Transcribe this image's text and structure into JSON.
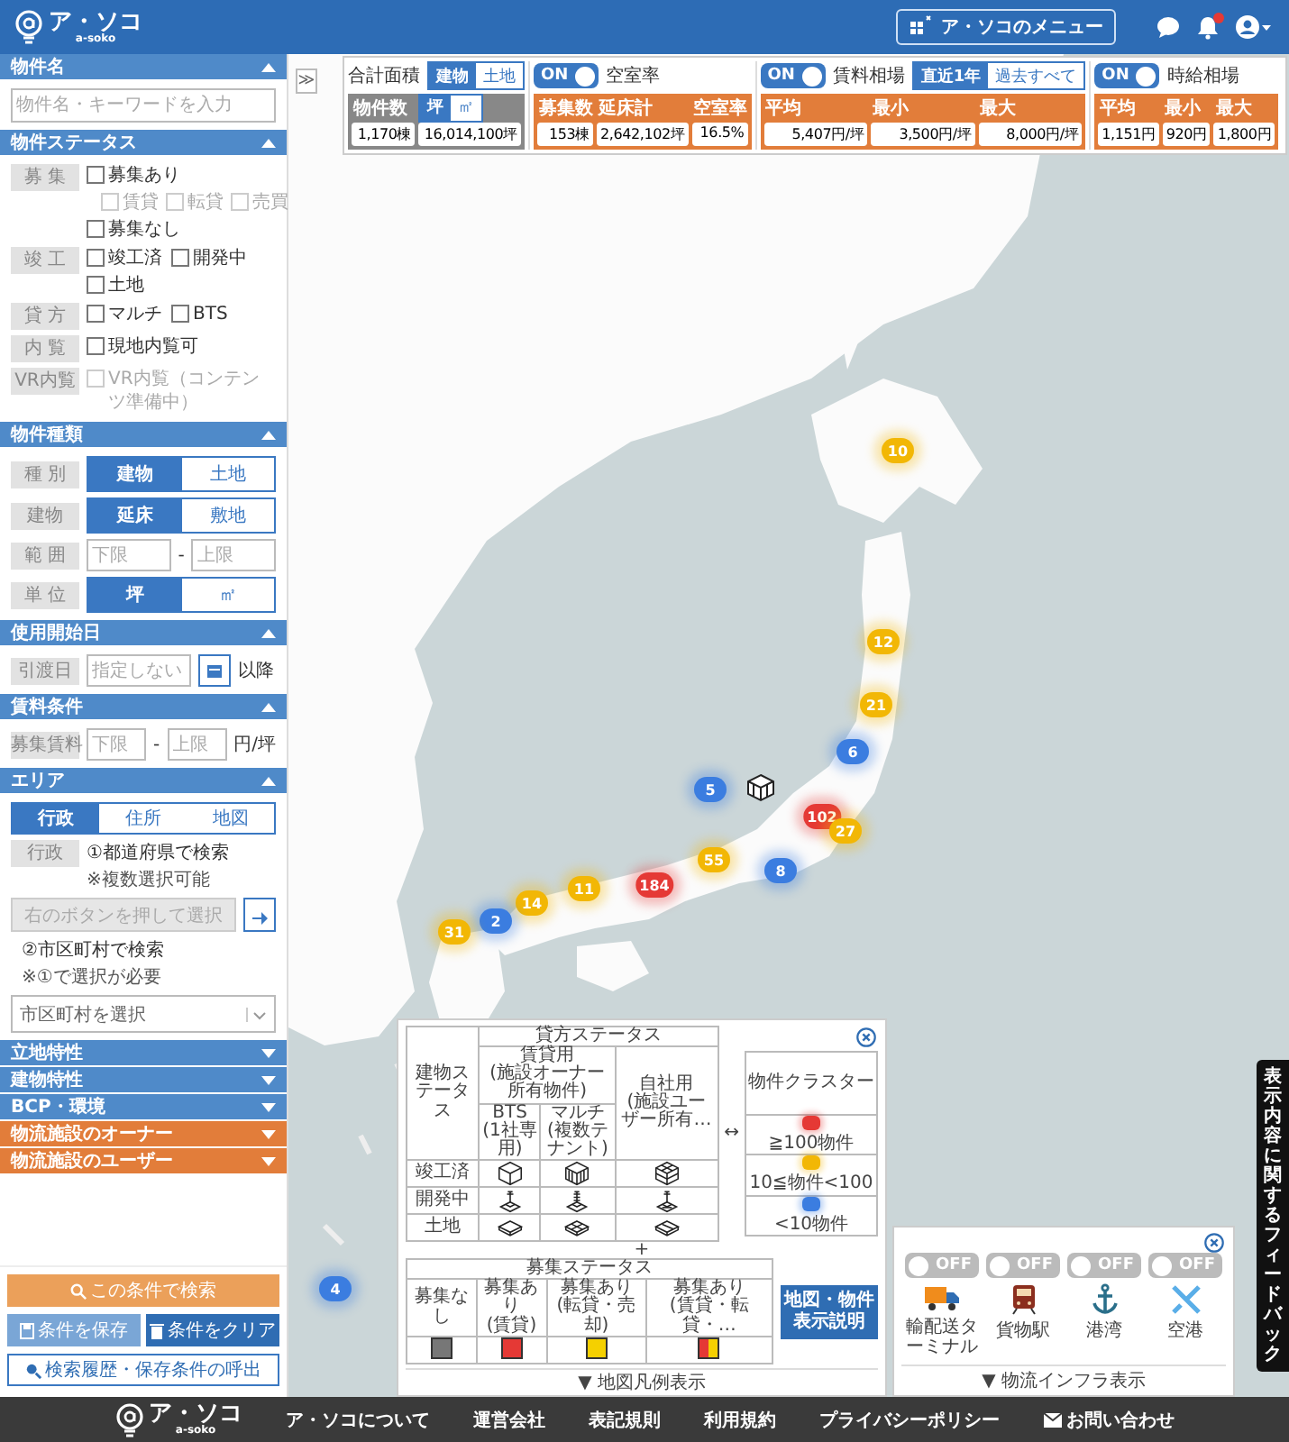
{
  "header": {
    "logo": "ア・ソコ",
    "logo_sub": "a-soko",
    "menu_button": "ア・ソコのメニュー"
  },
  "sidebar": {
    "sections": [
      {
        "kind": "keyword",
        "title": "物件名",
        "expanded": true,
        "color": "#4f8ac9",
        "placeholder": "物件名・キーワードを入力"
      },
      {
        "kind": "status",
        "title": "物件ステータス",
        "expanded": true,
        "color": "#4f8ac9",
        "rows": [
          {
            "label": "募 集",
            "kind": "stack",
            "options": [
              {
                "label": "募集あり",
                "checked": false,
                "disabled": false,
                "children": [
                  {
                    "label": "賃貸",
                    "checked": false,
                    "disabled": true
                  },
                  {
                    "label": "転貸",
                    "checked": false,
                    "disabled": true
                  },
                  {
                    "label": "売買",
                    "checked": false,
                    "disabled": true
                  }
                ]
              },
              {
                "label": "募集なし",
                "checked": false,
                "disabled": false
              }
            ]
          },
          {
            "label": "竣 工",
            "kind": "inline",
            "options": [
              {
                "label": "竣工済",
                "checked": false,
                "disabled": false
              },
              {
                "label": "開発中",
                "checked": false,
                "disabled": false
              },
              {
                "label": "土地",
                "checked": false,
                "disabled": false
              }
            ]
          },
          {
            "label": "貸 方",
            "kind": "inline",
            "options": [
              {
                "label": "マルチ",
                "checked": false,
                "disabled": false
              },
              {
                "label": "BTS",
                "checked": false,
                "disabled": false
              }
            ]
          },
          {
            "label": "内 覧",
            "kind": "inline",
            "options": [
              {
                "label": "現地内覧可",
                "checked": false,
                "disabled": false
              }
            ]
          },
          {
            "label": "VR内覧",
            "kind": "inline",
            "options": [
              {
                "label": "VR内覧（コンテンツ準備中）",
                "checked": false,
                "disabled": true
              }
            ]
          }
        ]
      },
      {
        "kind": "form",
        "title": "物件種類",
        "expanded": true,
        "color": "#4f8ac9",
        "rows": [
          {
            "kind": "segment",
            "label": "種 別",
            "options": [
              {
                "label": "建物",
                "selected": true
              },
              {
                "label": "土地",
                "selected": false
              }
            ]
          },
          {
            "kind": "segment",
            "label": "建物",
            "options": [
              {
                "label": "延床",
                "selected": true
              },
              {
                "label": "敷地",
                "selected": false
              }
            ]
          },
          {
            "kind": "range",
            "label": "範 囲",
            "min_placeholder": "下限",
            "separator": "-",
            "max_placeholder": "上限"
          },
          {
            "kind": "segment",
            "label": "単 位",
            "options": [
              {
                "label": "坪",
                "selected": true
              },
              {
                "label": "㎡",
                "selected": false
              }
            ]
          }
        ]
      },
      {
        "kind": "form",
        "title": "使用開始日",
        "expanded": true,
        "color": "#4f8ac9",
        "rows": [
          {
            "kind": "date",
            "label": "引渡日",
            "placeholder": "指定しない",
            "suffix": "以降"
          }
        ]
      },
      {
        "kind": "form",
        "title": "賃料条件",
        "expanded": true,
        "color": "#4f8ac9",
        "rows": [
          {
            "kind": "range",
            "label": "募集賃料",
            "min_placeholder": "下限",
            "separator": "-",
            "max_placeholder": "上限",
            "suffix": "円/坪"
          }
        ]
      },
      {
        "kind": "area",
        "title": "エリア",
        "expanded": true,
        "color": "#4f8ac9",
        "tabs": [
          {
            "label": "行政",
            "selected": true
          },
          {
            "label": "住所",
            "selected": false
          },
          {
            "label": "地図",
            "selected": false
          }
        ],
        "label": "行政",
        "step1": "①都道府県で検索",
        "step1_note": "※複数選択可能",
        "pick_button": "右のボタンを押して選択",
        "step2": "②市区町村で検索",
        "step2_note": "※①で選択が必要",
        "city_select": "市区町村を選択"
      },
      {
        "kind": "collapsed",
        "title": "立地特性",
        "expanded": false,
        "color": "#4f8ac9"
      },
      {
        "kind": "collapsed",
        "title": "建物特性",
        "expanded": false,
        "color": "#4f8ac9"
      },
      {
        "kind": "collapsed",
        "title": "BCP・環境",
        "expanded": false,
        "color": "#4f8ac9"
      },
      {
        "kind": "collapsed",
        "title": "物流施設のオーナー",
        "expanded": false,
        "color": "#e27d3a"
      },
      {
        "kind": "collapsed",
        "title": "物流施設のユーザー",
        "expanded": false,
        "color": "#e27d3a"
      }
    ],
    "actions": {
      "search": "この条件で検索",
      "save": "条件を保存",
      "clear": "条件をクリア",
      "history": "検索履歴・保存条件の呼出"
    }
  },
  "map": {
    "collapse_button": "≫",
    "stats": [
      {
        "kind": "area",
        "title": "合計面積",
        "toggle": [
          {
            "label": "建物",
            "selected": true
          },
          {
            "label": "土地",
            "selected": false
          }
        ],
        "count_label": "物件数",
        "unit_toggle": [
          {
            "label": "坪",
            "selected": true
          },
          {
            "label": "㎡",
            "selected": false
          }
        ],
        "values": [
          "1,170棟",
          "16,014,100坪"
        ]
      },
      {
        "kind": "metric",
        "on": true,
        "switch_label": "ON",
        "title": "空室率",
        "columns": [
          "募集数",
          "延床計",
          "空室率"
        ],
        "values": [
          "153棟",
          "2,642,102坪",
          "16.5%"
        ]
      },
      {
        "kind": "metric",
        "on": true,
        "switch_label": "ON",
        "title": "賃料相場",
        "toggle": [
          {
            "label": "直近1年",
            "selected": true
          },
          {
            "label": "過去すべて",
            "selected": false
          }
        ],
        "columns": [
          "平均",
          "最小",
          "最大"
        ],
        "values": [
          "5,407円/坪",
          "3,500円/坪",
          "8,000円/坪"
        ]
      },
      {
        "kind": "metric",
        "on": true,
        "switch_label": "ON",
        "title": "時給相場",
        "columns": [
          "平均",
          "最小",
          "最大"
        ],
        "values": [
          "1,151円",
          "920円",
          "1,800円"
        ]
      }
    ],
    "clusters": [
      {
        "count": "10",
        "color": "#f2b705"
      },
      {
        "count": "12",
        "color": "#f2b705"
      },
      {
        "count": "21",
        "color": "#f2b705"
      },
      {
        "count": "6",
        "color": "#3b7de0"
      },
      {
        "count": "5",
        "color": "#3b7de0"
      },
      {
        "count": "102",
        "color": "#e53935"
      },
      {
        "count": "27",
        "color": "#f2b705"
      },
      {
        "count": "55",
        "color": "#f2b705"
      },
      {
        "count": "8",
        "color": "#3b7de0"
      },
      {
        "count": "184",
        "color": "#e53935"
      },
      {
        "count": "11",
        "color": "#f2b705"
      },
      {
        "count": "14",
        "color": "#f2b705"
      },
      {
        "count": "2",
        "color": "#3b7de0"
      },
      {
        "count": "31",
        "color": "#f2b705"
      },
      {
        "count": "4",
        "color": "#3b7de0"
      }
    ],
    "feedback": "表示内容に関するフィードバック"
  },
  "legend": {
    "lessor_title": "貸方ステータス",
    "status_heading": "建物ステータス",
    "rental": {
      "label": "賃貸用",
      "note": "(施設オーナー所有物件)",
      "types": [
        {
          "label": "BTS",
          "note": "(1社専用)"
        },
        {
          "label": "マルチ",
          "note": "(複数テナント)"
        }
      ]
    },
    "own": {
      "label": "自社用",
      "note": "(施設ユーザー所有…"
    },
    "rows": [
      {
        "label": "竣工済",
        "kind": "built"
      },
      {
        "label": "開発中",
        "kind": "developing"
      },
      {
        "label": "土地",
        "kind": "land"
      }
    ],
    "link": "↔",
    "cluster_title": "物件クラスター",
    "clusters": [
      {
        "label": "≧100物件",
        "color": "#e53935"
      },
      {
        "label": "10≦物件<100",
        "color": "#f2b705"
      },
      {
        "label": "<10物件",
        "color": "#3b7de0"
      }
    ],
    "plus": "+",
    "recruit_title": "募集ステータス",
    "recruit": [
      {
        "label": "募集なし",
        "swatches": [
          {
            "color": "#777777"
          }
        ]
      },
      {
        "label": "募集あり",
        "note": "(賃貸)",
        "swatches": [
          {
            "color": "#e53935"
          }
        ]
      },
      {
        "label": "募集あり",
        "note": "(転貸・売却)",
        "swatches": [
          {
            "color": "#f5d000"
          }
        ]
      },
      {
        "label": "募集あり",
        "note": "(賃貸・転貸・…",
        "swatches": [
          {
            "color": "#e53935"
          },
          {
            "color": "#f5d000"
          }
        ]
      }
    ],
    "explain_button": "地図・物件表示説明",
    "toggle": "▼ 地図凡例表示"
  },
  "infra": {
    "items": [
      {
        "kind": "truck",
        "switch_label": "OFF",
        "on": false,
        "label": "輸配送ターミナル"
      },
      {
        "kind": "train",
        "switch_label": "OFF",
        "on": false,
        "label": "貨物駅"
      },
      {
        "kind": "anchor",
        "switch_label": "OFF",
        "on": false,
        "label": "港湾"
      },
      {
        "kind": "plane",
        "switch_label": "OFF",
        "on": false,
        "label": "空港"
      }
    ],
    "toggle": "▼ 物流インフラ表示"
  },
  "footer": {
    "logo": "ア・ソコ",
    "logo_sub": "a-soko",
    "links": [
      {
        "label": "ア・ソコについて",
        "kind": "text"
      },
      {
        "label": "運営会社",
        "kind": "text"
      },
      {
        "label": "表記規則",
        "kind": "text"
      },
      {
        "label": "利用規約",
        "kind": "text"
      },
      {
        "label": "プライバシーポリシー",
        "kind": "text"
      },
      {
        "label": "お問い合わせ",
        "kind": "mail"
      }
    ]
  }
}
